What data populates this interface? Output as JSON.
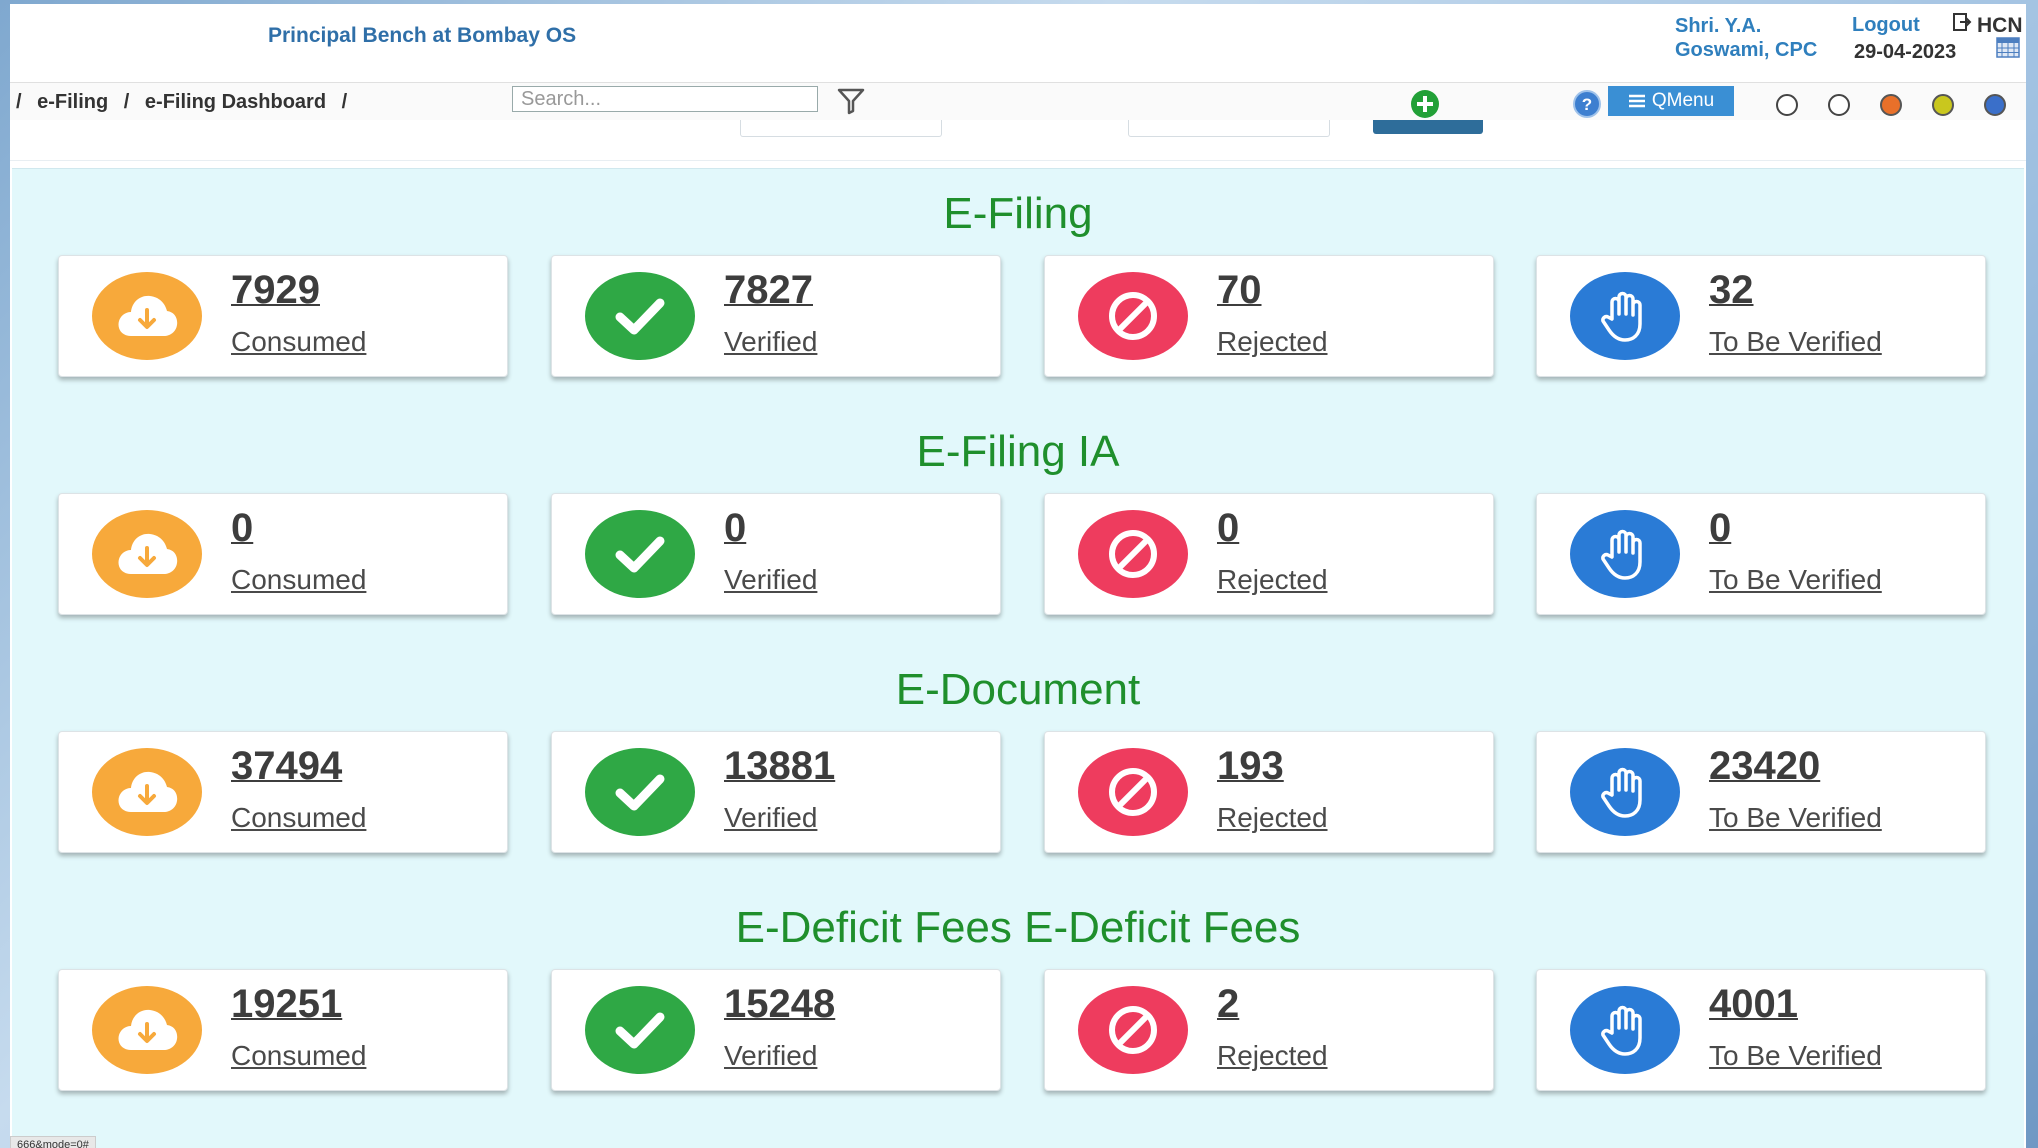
{
  "header": {
    "court_title": "Principal Bench at Bombay OS",
    "user_line1": "Shri. Y.A.",
    "user_line2": "Goswami, CPC",
    "logout_label": "Logout",
    "court_code": "HCN",
    "date": "29-04-2023"
  },
  "navbar": {
    "breadcrumb": [
      "/",
      "e-Filing",
      "/",
      "e-Filing Dashboard",
      "/"
    ],
    "search_placeholder": "Search...",
    "qmenu_label": "QMenu",
    "theme_colors": [
      "#ffffff",
      "#ffffff",
      "#e8702a",
      "#c9c71e",
      "#3a6fc9"
    ]
  },
  "icons": {
    "consumed": "cloud-download-icon",
    "verified": "check-icon",
    "rejected": "ban-icon",
    "to_be_verified": "hand-icon"
  },
  "colors": {
    "consumed": "#f7a93b",
    "verified": "#2fa845",
    "rejected": "#ee3c5e",
    "to_be_verified": "#2a7bd6",
    "section_title": "#1f8f2c"
  },
  "sections": [
    {
      "title": "E-Filing",
      "cards": [
        {
          "value": "7929",
          "label": "Consumed"
        },
        {
          "value": "7827",
          "label": "Verified"
        },
        {
          "value": "70",
          "label": "Rejected"
        },
        {
          "value": "32",
          "label": "To Be Verified"
        }
      ]
    },
    {
      "title": "E-Filing IA",
      "cards": [
        {
          "value": "0",
          "label": "Consumed"
        },
        {
          "value": "0",
          "label": "Verified"
        },
        {
          "value": "0",
          "label": "Rejected"
        },
        {
          "value": "0",
          "label": "To Be Verified"
        }
      ]
    },
    {
      "title": "E-Document",
      "cards": [
        {
          "value": "37494",
          "label": "Consumed"
        },
        {
          "value": "13881",
          "label": "Verified"
        },
        {
          "value": "193",
          "label": "Rejected"
        },
        {
          "value": "23420",
          "label": "To Be Verified"
        }
      ]
    },
    {
      "title": "E-Deficit Fees E-Deficit Fees",
      "cards": [
        {
          "value": "19251",
          "label": "Consumed"
        },
        {
          "value": "15248",
          "label": "Verified"
        },
        {
          "value": "2",
          "label": "Rejected"
        },
        {
          "value": "4001",
          "label": "To Be Verified"
        }
      ]
    }
  ],
  "status_bar": {
    "url_fragment": "666&mode=0#"
  }
}
